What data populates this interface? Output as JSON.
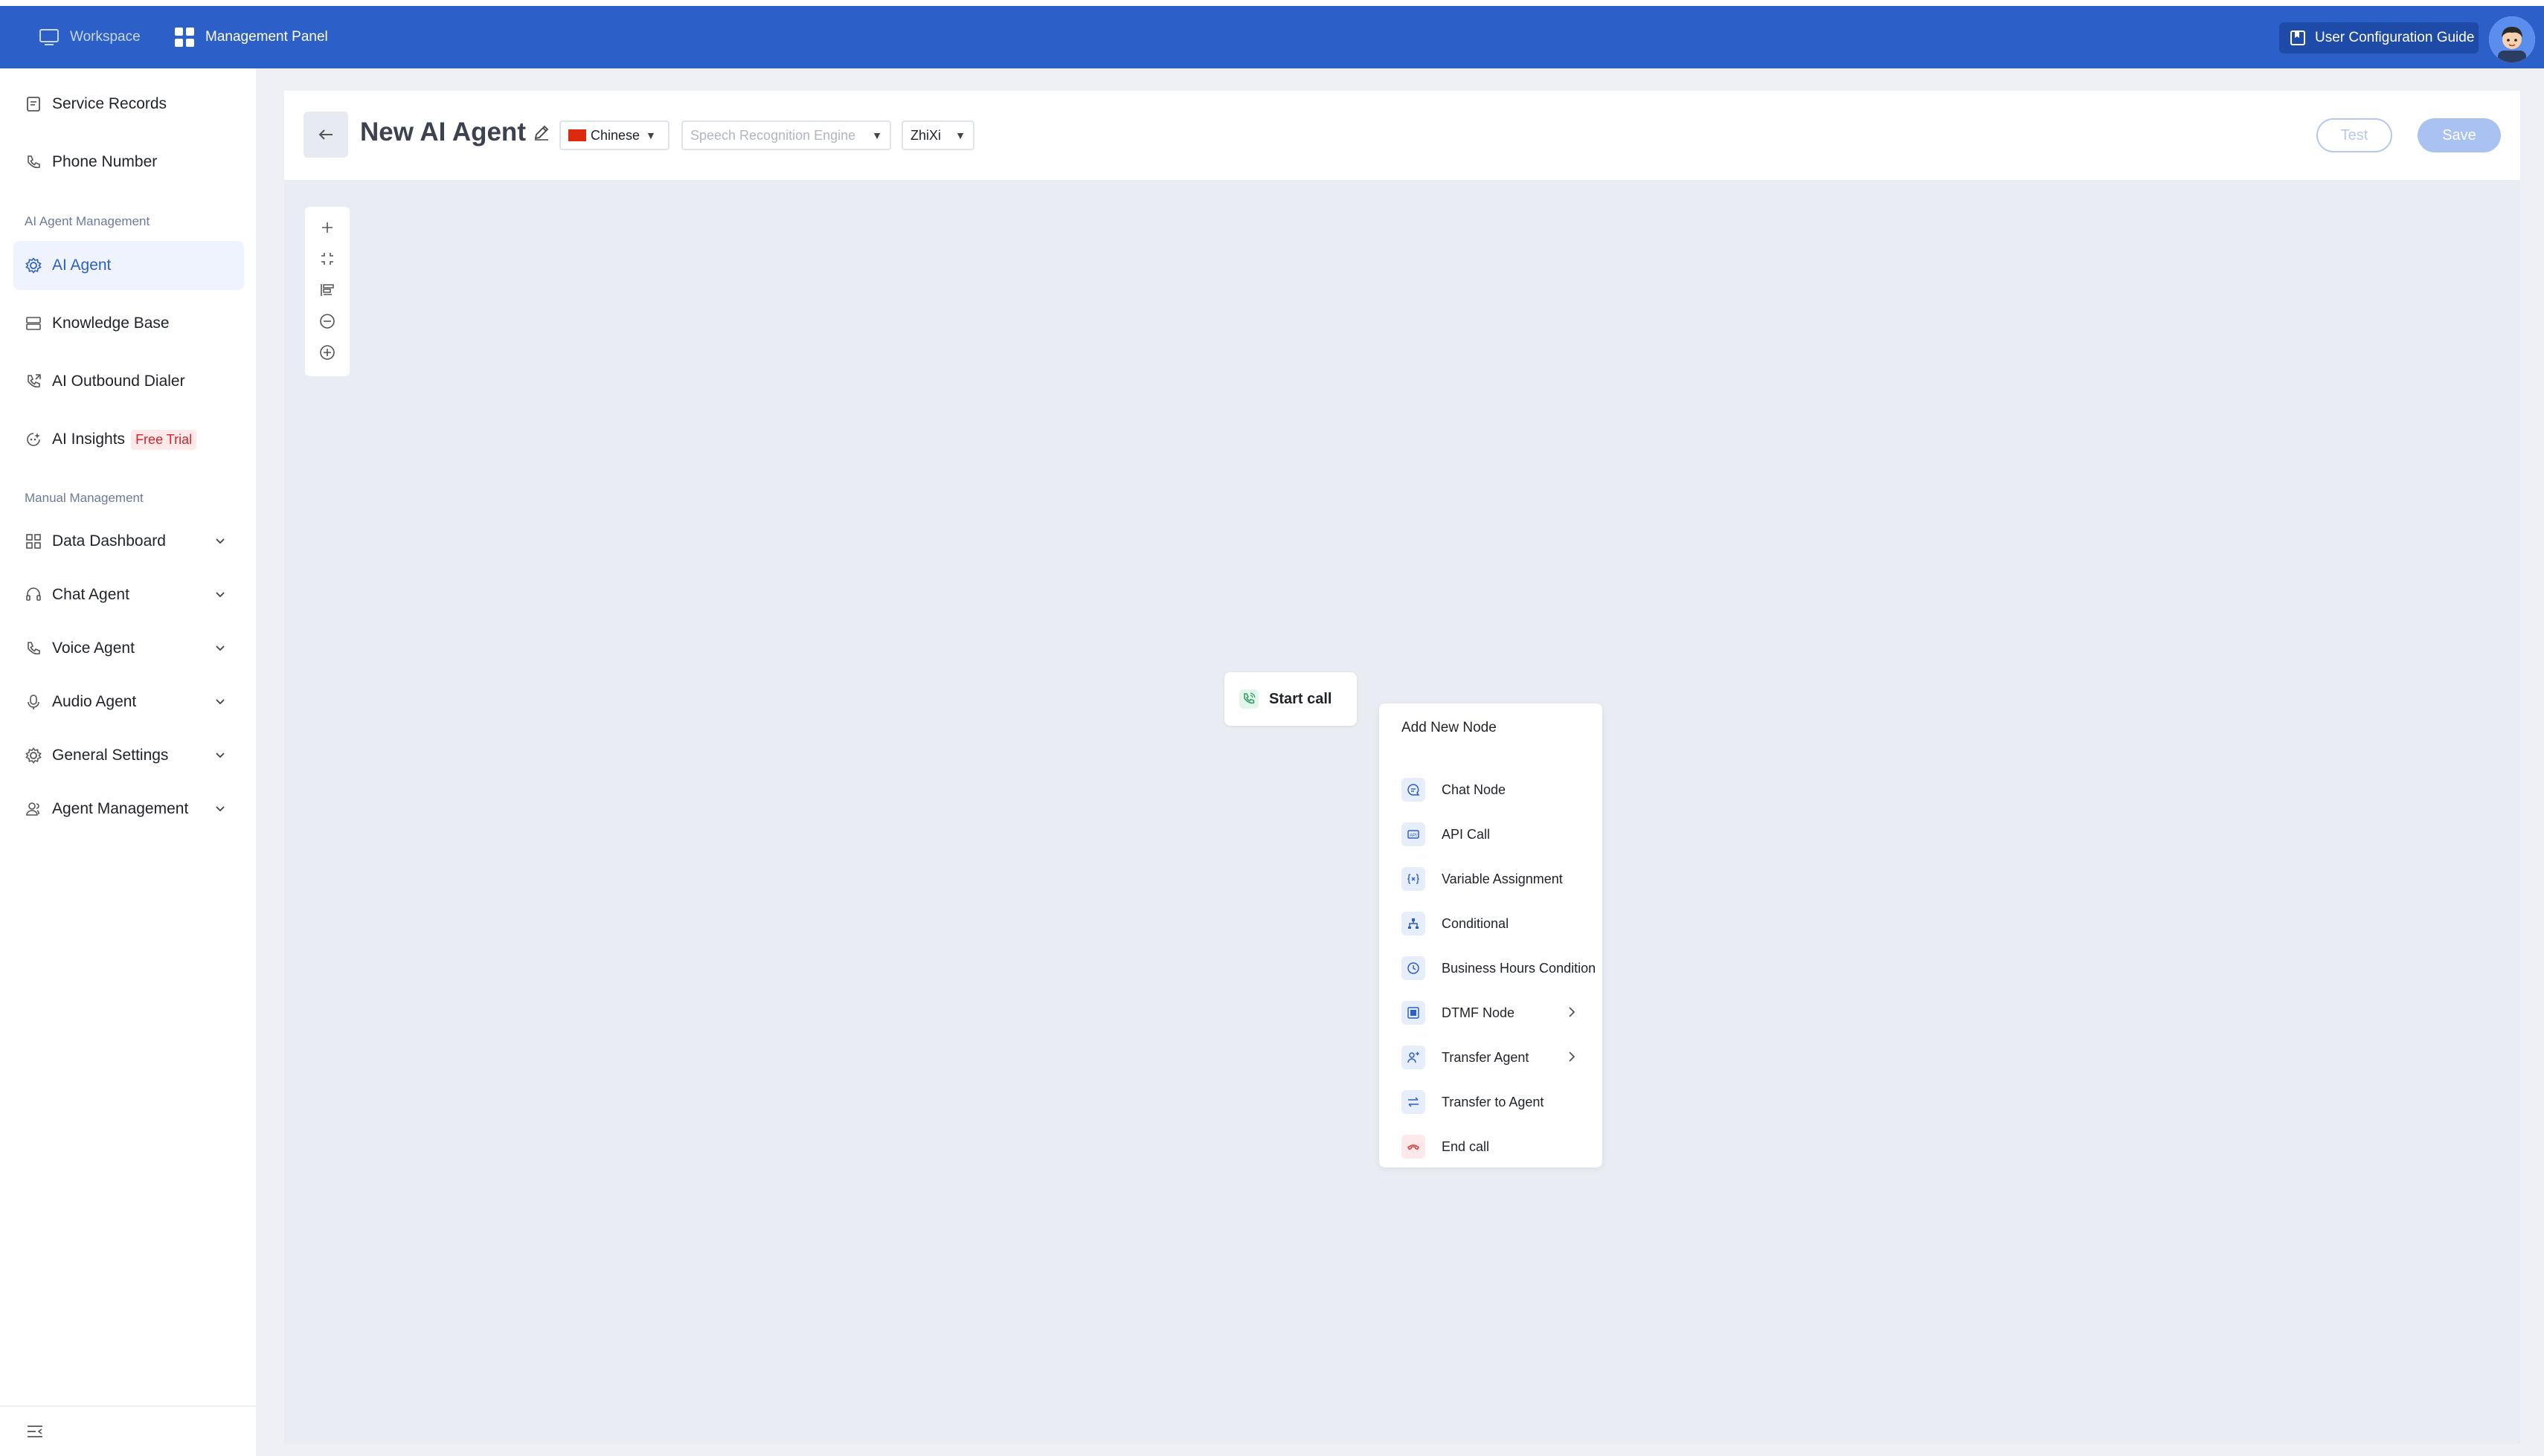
{
  "topbar": {
    "workspace_label": "Workspace",
    "management_label": "Management Panel",
    "guide_label": "User Configuration Guide"
  },
  "sidebar": {
    "items_top": [
      {
        "label": "Service Records",
        "icon": "document-icon"
      },
      {
        "label": "Phone Number",
        "icon": "phone-icon"
      }
    ],
    "section_ai": "AI Agent Management",
    "items_ai": [
      {
        "label": "AI Agent",
        "icon": "gear-icon",
        "active": true
      },
      {
        "label": "Knowledge Base",
        "icon": "database-icon"
      },
      {
        "label": "AI Outbound Dialer",
        "icon": "phone-outgoing-icon"
      },
      {
        "label": "AI Insights",
        "icon": "insights-icon",
        "badge": "Free Trial"
      }
    ],
    "section_manual": "Manual Management",
    "items_manual": [
      {
        "label": "Data Dashboard",
        "icon": "grid-icon"
      },
      {
        "label": "Chat Agent",
        "icon": "headset-icon"
      },
      {
        "label": "Voice Agent",
        "icon": "phone-icon"
      },
      {
        "label": "Audio Agent",
        "icon": "microphone-icon"
      },
      {
        "label": "General Settings",
        "icon": "gear-icon"
      },
      {
        "label": "Agent Management",
        "icon": "users-icon"
      }
    ]
  },
  "header": {
    "title": "New AI Agent",
    "language": "Chinese",
    "speech_engine_placeholder": "Speech Recognition Engine",
    "voice": "ZhiXi",
    "test_label": "Test",
    "save_label": "Save"
  },
  "canvas": {
    "start_node_label": "Start call",
    "menu": {
      "title": "Add New Node",
      "items": [
        {
          "label": "Chat Node",
          "icon": "chat-icon"
        },
        {
          "label": "API Call",
          "icon": "api-icon"
        },
        {
          "label": "Variable Assignment",
          "icon": "variable-icon"
        },
        {
          "label": "Conditional",
          "icon": "branch-icon"
        },
        {
          "label": "Business Hours Condition",
          "icon": "clock-icon"
        },
        {
          "label": "DTMF Node",
          "icon": "keypad-icon",
          "submenu": true
        },
        {
          "label": "Transfer Agent",
          "icon": "transfer-user-icon",
          "submenu": true
        },
        {
          "label": "Transfer to Agent",
          "icon": "swap-icon"
        },
        {
          "label": "End call",
          "icon": "hangup-icon",
          "danger": true
        }
      ]
    }
  },
  "colors": {
    "brand": "#2d5fc9",
    "accent_light": "#eef3fd",
    "badge_red": "#d4242a",
    "canvas_bg": "#e9ecf2"
  }
}
